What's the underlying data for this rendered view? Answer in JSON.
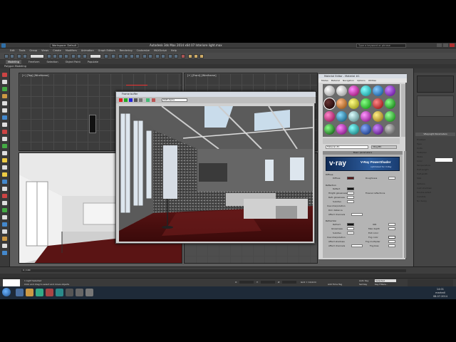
{
  "app": {
    "title": "Autodesk 3ds Max 2014 x64    07 Interiore light.max",
    "workspace": "Workspace: Default",
    "search_placeholder": "Type a keyword or phrase"
  },
  "menu": [
    "Edit",
    "Tools",
    "Group",
    "Views",
    "Create",
    "Modifiers",
    "Animation",
    "Graph Editors",
    "Rendering",
    "Customize",
    "MAXScript",
    "Help"
  ],
  "ribbon": {
    "tabs": [
      "Modeling",
      "Freeform",
      "Selection",
      "Object Paint",
      "Populate"
    ],
    "sub_label": "Polygon Modeling"
  },
  "viewports": {
    "top_label": "[+] [Top] [Wireframe]",
    "front_label": "[+] [Front] [Wireframe]"
  },
  "frame_buffer": {
    "title": "Frame buffer",
    "channel": "RGB Alpha"
  },
  "material_editor": {
    "title": "Material Editor - Material #1",
    "menu": [
      "Modes",
      "Material",
      "Navigation",
      "Options",
      "Utilities"
    ],
    "material_name": "Material #1",
    "material_type": "VRayMtl",
    "rollout_title": "Basic parameters",
    "vray_logo": "v·ray",
    "vray_product": "V-Ray PowerShader",
    "vray_tagline": "optimized for V-Ray",
    "diffuse_section": "Diffuse",
    "diffuse_label": "Diffuse",
    "roughness_label": "Roughness",
    "reflection_section": "Reflection",
    "reflect_labels": [
      "Reflect",
      "Hilight glossiness",
      "Refl. glossiness",
      "Subdivs",
      "Use interpolation",
      "Dim distance",
      "Affect channels"
    ],
    "fresnel_label": "Fresnel reflections",
    "refraction_section": "Refraction",
    "refract_labels": [
      "Refract",
      "Glossiness",
      "Subdivs",
      "Use interpolation",
      "Affect shadows",
      "Affect channels"
    ],
    "refract_right_labels": [
      "IOR",
      "Max depth",
      "Exit color",
      "Fog color",
      "Fog multiplier",
      "Fog bias"
    ]
  },
  "command_panel": {
    "rollout": "VRayLight Parameters",
    "fields": [
      "Enabled",
      "Type",
      "Units",
      "Multiplier",
      "Mode",
      "Color",
      "Temperature",
      "Half-length",
      "Half-width",
      "Size",
      "Options",
      "Cast shadows",
      "Double-sided",
      "Invisible",
      "No decay"
    ]
  },
  "timeline": {
    "frame": "0 / 100"
  },
  "status": {
    "line1": "1 Light Selected",
    "line2": "Click and drag to select and move objects",
    "coords": [
      "X:",
      "Y:",
      "Z:"
    ],
    "grid": "Grid = 10,0cm",
    "add_time_tag": "Add Time Tag",
    "auto_key": "Auto Key",
    "selected": "Selected",
    "set_key": "Set Key",
    "key_filters": "Key Filters..."
  },
  "taskbar": {
    "time": "14:01",
    "day": "martedì",
    "date": "08.07.2014"
  },
  "colors": {
    "vray_blue": "#2b5b9c",
    "viewport_bg": "#3c3c3c",
    "floor_red": "#5a1414"
  }
}
